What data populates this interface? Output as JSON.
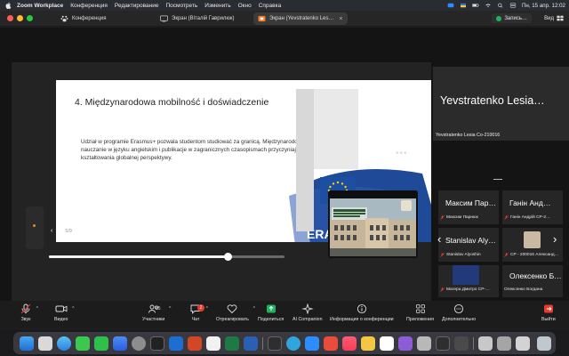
{
  "menubar": {
    "items": [
      "Zoom Workplace",
      "Конференция",
      "Редактирование",
      "Посмотреть",
      "Изменить",
      "Окно",
      "Справка"
    ],
    "clock": "Пн, 15 апр.  12:02"
  },
  "tabs": [
    {
      "label": "Конференция"
    },
    {
      "label": "Экран (Віталій Гаврилюк)"
    },
    {
      "label": "Экран (Yevstratenko Les…"
    }
  ],
  "titlebar": {
    "share_label": "Запись…",
    "view_label": "Вид"
  },
  "slide": {
    "title": "4. Międzynarodowa mobilność i doświadczenie",
    "body": "Udział w programie Erasmus+ pozwala studentom studiować za granicą. Międzynarodowe konferencje, nauczanie w języku angielskim i publikacje w zagranicznych czasopismach przyczyniają się do kształtowania globalnej perspektywy.",
    "logo_text": "ERAS",
    "counter": "5/9",
    "progress": 0.76
  },
  "speaker": {
    "display_name": "Yevstratenko Lesia…",
    "label": "Yevstratenko Lesia Co-210016"
  },
  "participants": [
    {
      "big": "Максим Пар…",
      "small": "Максим Парнюк"
    },
    {
      "big": "Ганін Анд…",
      "small": "Ганін Андрій СР-2…"
    },
    {
      "big": "Stanislav Aly…",
      "small": "Stanislav Alyoshin"
    },
    {
      "big": "",
      "small": "СР - 200016 Александ…"
    },
    {
      "big": "",
      "small": "Магера Дмитро СР-…"
    },
    {
      "big": "Олексенко Б…",
      "small": "Олексенко Богдана"
    }
  ],
  "toolbar": {
    "items": [
      {
        "label": "Звук"
      },
      {
        "label": "Видео"
      },
      {
        "label": "Участники",
        "count": "85"
      },
      {
        "label": "Чат",
        "badge": "2"
      },
      {
        "label": "Отреагировать"
      },
      {
        "label": "Поделиться"
      },
      {
        "label": "AI Companion"
      },
      {
        "label": "Информация о конференции"
      },
      {
        "label": "Приложения"
      },
      {
        "label": "Дополнительно"
      },
      {
        "label": "Выйти"
      }
    ]
  },
  "colors": {
    "share_green": "#24b15f",
    "leave_red": "#e53b30",
    "accent_blue": "#2d8cff"
  }
}
